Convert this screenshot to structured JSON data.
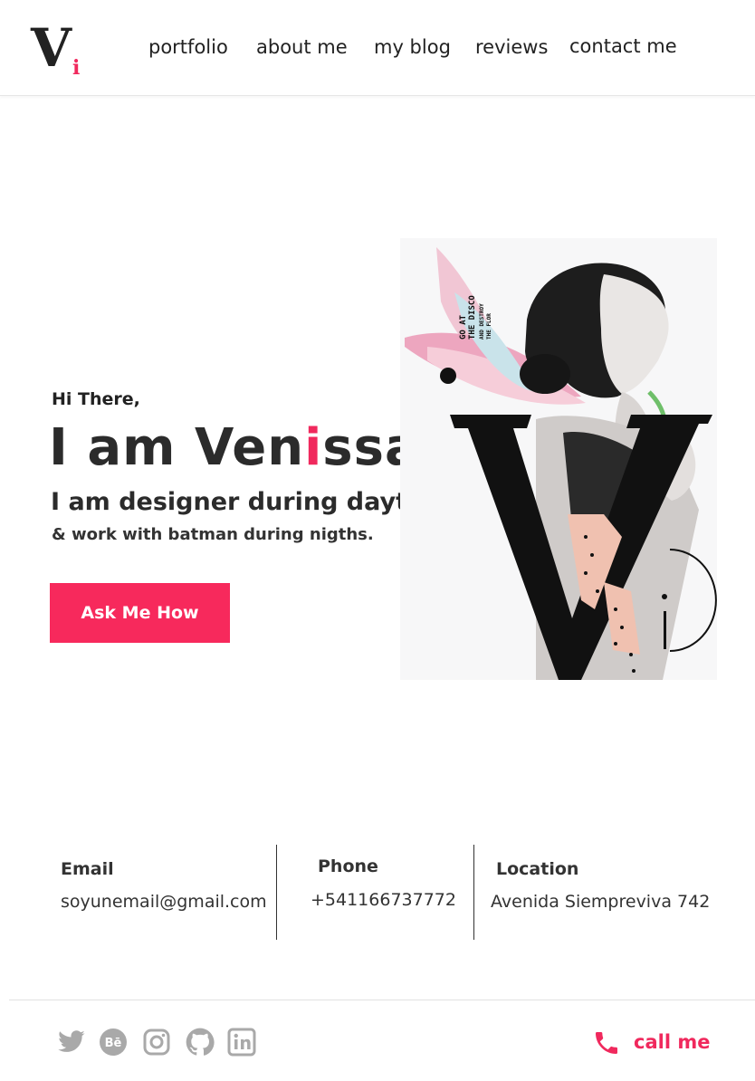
{
  "brand": {
    "logo_letter": "V",
    "logo_accent": "i",
    "accent_color": "#f0295d"
  },
  "nav": {
    "items": [
      {
        "label": "portfolio"
      },
      {
        "label": "about me"
      },
      {
        "label": "my blog"
      },
      {
        "label": "reviews"
      },
      {
        "label": "contact me"
      }
    ]
  },
  "hero": {
    "greeting": "Hi There,",
    "name_prefix": "I am Ven",
    "name_accent": "i",
    "name_suffix": "ssa",
    "tagline": "I am designer during daytime",
    "subline": "& work with batman during nigths.",
    "cta_label": "Ask Me How",
    "poster_text_1": "GO AT",
    "poster_text_2": "THE DISCO",
    "poster_text_3": "AND DESTROY",
    "poster_text_4": "THE FLOR"
  },
  "contact": {
    "email": {
      "label": "Email",
      "value": "soyunemail@gmail.com"
    },
    "phone": {
      "label": "Phone",
      "value": "+541166737772"
    },
    "location": {
      "label": "Location",
      "value": "Avenida Siempreviva 742"
    }
  },
  "footer": {
    "socials": [
      "twitter-icon",
      "behance-icon",
      "instagram-icon",
      "github-icon",
      "linkedin-icon"
    ],
    "icon_color": "#a9a9a9",
    "call_label": "call me"
  }
}
